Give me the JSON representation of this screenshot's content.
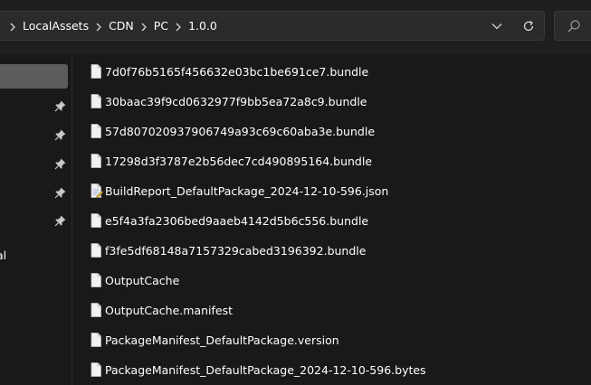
{
  "address_bar": {
    "breadcrumb": [
      "LocalAssets",
      "CDN",
      "PC",
      "1.0.0"
    ]
  },
  "nav_pane": {
    "pinned_count": 5,
    "partial_label": "al"
  },
  "files": [
    {
      "name": "7d0f76b5165f456632e03bc1be691ce7.bundle",
      "icon": "blank-file-icon"
    },
    {
      "name": "30baac39f9cd0632977f9bb5ea72a8c9.bundle",
      "icon": "blank-file-icon"
    },
    {
      "name": "57d807020937906749a93c69c60aba3e.bundle",
      "icon": "blank-file-icon"
    },
    {
      "name": "17298d3f3787e2b56dec7cd490895164.bundle",
      "icon": "blank-file-icon"
    },
    {
      "name": "BuildReport_DefaultPackage_2024-12-10-596.json",
      "icon": "json-file-icon"
    },
    {
      "name": "e5f4a3fa2306bed9aaeb4142d5b6c556.bundle",
      "icon": "blank-file-icon"
    },
    {
      "name": "f3fe5df68148a7157329cabed3196392.bundle",
      "icon": "blank-file-icon"
    },
    {
      "name": "OutputCache",
      "icon": "blank-file-icon"
    },
    {
      "name": "OutputCache.manifest",
      "icon": "blank-file-icon"
    },
    {
      "name": "PackageManifest_DefaultPackage.version",
      "icon": "blank-file-icon"
    },
    {
      "name": "PackageManifest_DefaultPackage_2024-12-10-596.bytes",
      "icon": "blank-file-icon"
    }
  ],
  "colors": {
    "background": "#191919",
    "toolbar": "#1f1f1f",
    "field": "#2b2b2b",
    "nav_selected": "#5c5c5c",
    "text": "#ffffff",
    "json_icon_accent": "#f5c542"
  }
}
